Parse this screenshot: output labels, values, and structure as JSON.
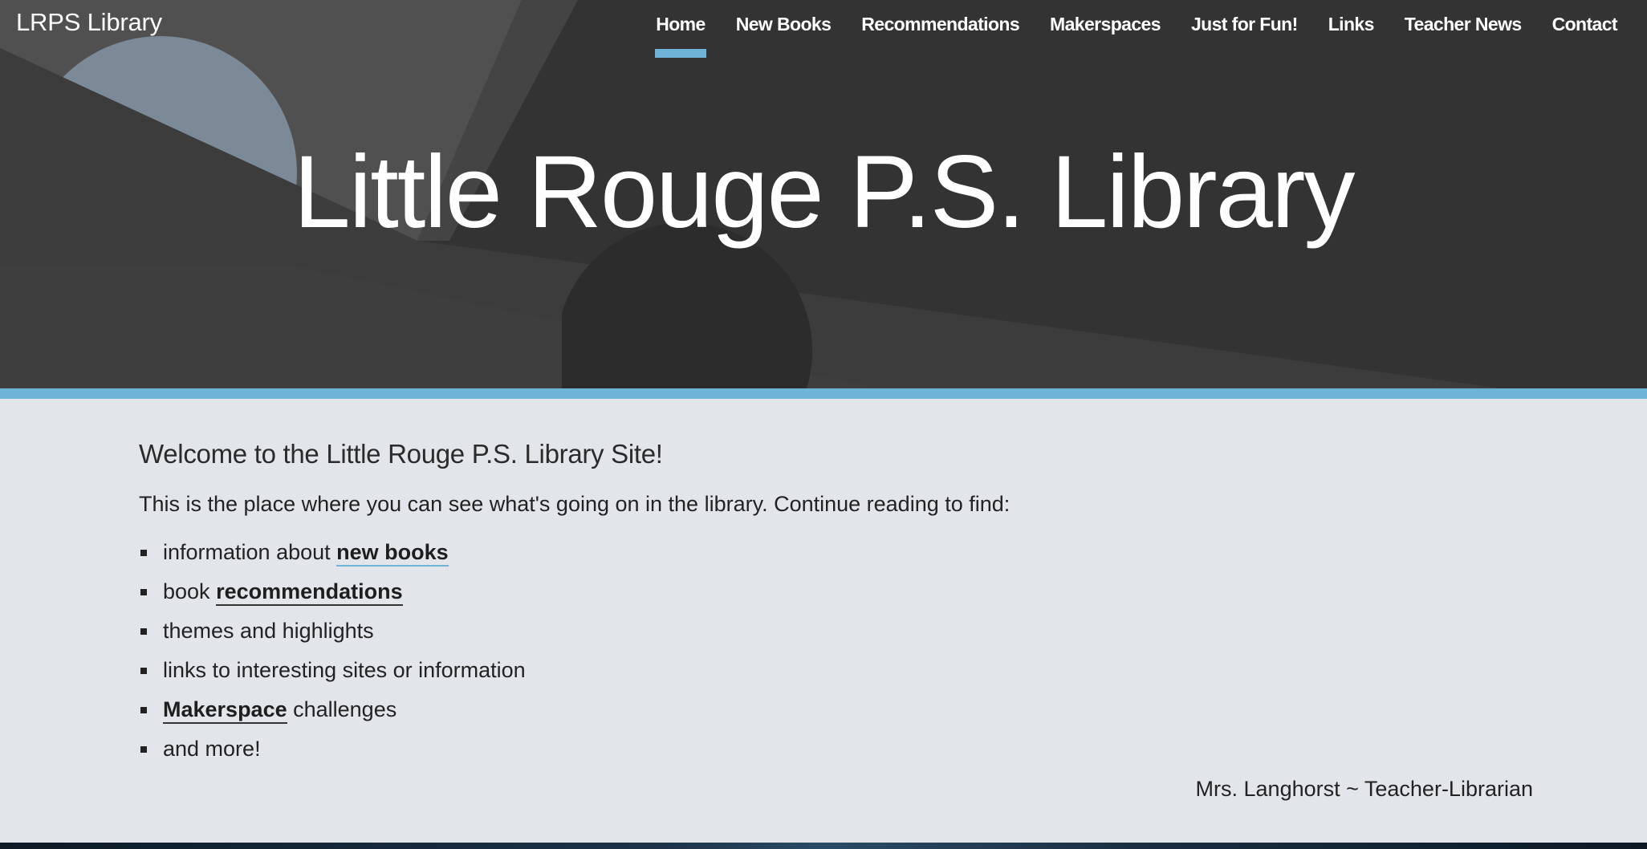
{
  "brand": "LRPS Library",
  "nav": [
    {
      "label": "Home",
      "active": true
    },
    {
      "label": "New Books"
    },
    {
      "label": "Recommendations"
    },
    {
      "label": "Makerspaces"
    },
    {
      "label": "Just for Fun!"
    },
    {
      "label": "Links"
    },
    {
      "label": "Teacher News"
    },
    {
      "label": "Contact"
    }
  ],
  "hero": {
    "title": "Little Rouge P.S. Library"
  },
  "content": {
    "welcome": "Welcome to the Little Rouge P.S. Library Site!",
    "intro": "This is the place where you can see what's going on in the library. Continue reading to find:",
    "items": [
      {
        "prefix": "information about ",
        "link": "new books",
        "suffix": ""
      },
      {
        "prefix": "book ",
        "link": "recommendations",
        "suffix": ""
      },
      {
        "prefix": "themes and highlights",
        "link": "",
        "suffix": ""
      },
      {
        "prefix": "links to interesting sites or information",
        "link": "",
        "suffix": ""
      },
      {
        "prefix": "",
        "link": "Makerspace",
        "suffix": " challenges"
      },
      {
        "prefix": "and more!",
        "link": "",
        "suffix": ""
      }
    ],
    "signature": "Mrs. Langhorst ~ Teacher-Librarian"
  },
  "colors": {
    "accent": "#6eb3d8",
    "hero_bg": "#3a3a3a",
    "content_bg": "#e2e6eb"
  }
}
